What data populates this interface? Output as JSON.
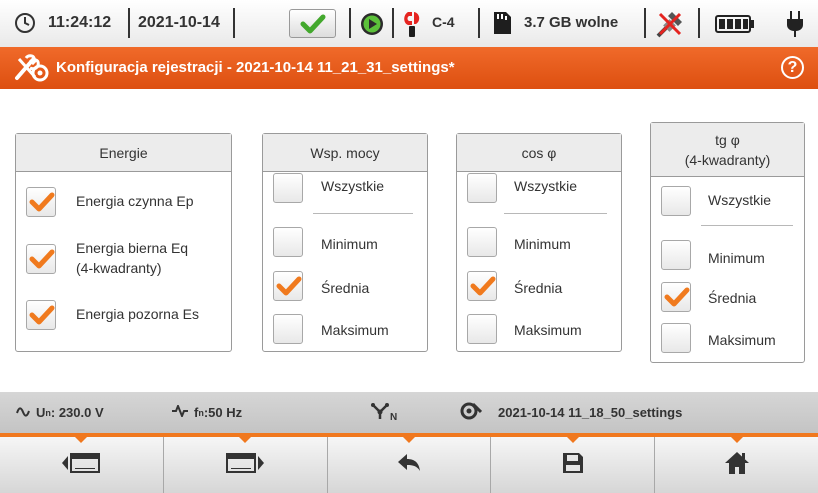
{
  "status": {
    "time": "11:24:12",
    "date": "2021-10-14",
    "channel": "C-4",
    "storage": "3.7 GB wolne"
  },
  "title": "Konfiguracja rejestracji - 2021-10-14 11_21_31_settings*",
  "panels": {
    "energy": {
      "header": "Energie",
      "items": [
        {
          "label_line1": "Energia czynna Ep",
          "label_line2": "",
          "checked": true
        },
        {
          "label_line1": "Energia bierna Eq",
          "label_line2": "(4-kwadranty)",
          "checked": true
        },
        {
          "label_line1": "Energia pozorna Es",
          "label_line2": "",
          "checked": true
        }
      ]
    },
    "power_factor": {
      "header": "Wsp. mocy",
      "all_label": "Wszystkie",
      "items": [
        {
          "label": "Minimum",
          "checked": false
        },
        {
          "label": "Średnia",
          "checked": true
        },
        {
          "label": "Maksimum",
          "checked": false
        }
      ]
    },
    "cos_phi": {
      "header": "cos φ",
      "all_label": "Wszystkie",
      "items": [
        {
          "label": "Minimum",
          "checked": false
        },
        {
          "label": "Średnia",
          "checked": true
        },
        {
          "label": "Maksimum",
          "checked": false
        }
      ]
    },
    "tg_phi": {
      "header_line1": "tg φ",
      "header_line2": "(4-kwadranty)",
      "all_label": "Wszystkie",
      "items": [
        {
          "label": "Minimum",
          "checked": false
        },
        {
          "label": "Średnia",
          "checked": true
        },
        {
          "label": "Maksimum",
          "checked": false
        }
      ]
    }
  },
  "infobar": {
    "voltage_sym": "U",
    "voltage_sub": "n",
    "voltage_val": ": 230.0 V",
    "freq_sym": "f",
    "freq_sub": "n",
    "freq_val": ":50 Hz",
    "network_sub": "N",
    "settings_file": "2021-10-14 11_18_50_settings"
  },
  "buttons": [
    "prev-screen-icon",
    "next-screen-icon",
    "back-arrow-icon",
    "save-disk-icon",
    "home-icon"
  ],
  "colors": {
    "accent": "#f0781e",
    "title_bar": "#e85b1a",
    "check": "#f07a1e",
    "ok_green": "#43a82d"
  }
}
